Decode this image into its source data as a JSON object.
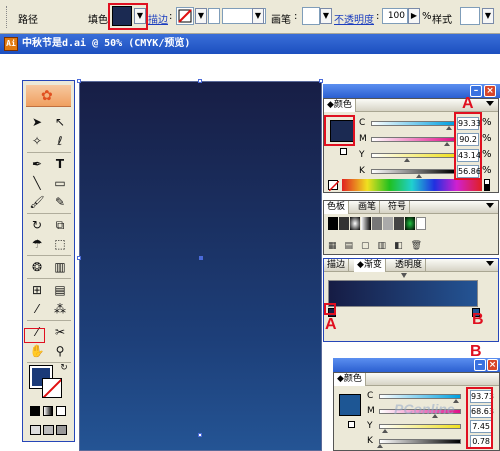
{
  "control_bar": {
    "path_label": "路径",
    "fill_label": "填色",
    "stroke_label": "描边",
    "brush_label": "画笔",
    "opacity_label": "不透明度",
    "opacity_value": "100",
    "opacity_unit": "%",
    "style_label": "样式"
  },
  "document": {
    "title": "中秋节是d.ai @ 50% (CMYK/预览)",
    "icon_text": "Ai"
  },
  "color_panel_top": {
    "tab": "颜色",
    "channels": [
      {
        "name": "C",
        "value": "93.33",
        "level": 93.33
      },
      {
        "name": "M",
        "value": "90.2",
        "level": 90.2
      },
      {
        "name": "Y",
        "value": "43.14",
        "level": 43.14
      },
      {
        "name": "K",
        "value": "56.86",
        "level": 56.86
      }
    ],
    "pct": "%",
    "annotation": "A"
  },
  "swatches_panel": {
    "tabs": [
      "色板",
      "画笔",
      "符号"
    ]
  },
  "gradient_panel": {
    "tabs": [
      "描边",
      "渐变",
      "透明度"
    ],
    "left_marker": "A",
    "right_marker": "B"
  },
  "color_panel_bottom": {
    "tab": "颜色",
    "channels": [
      {
        "name": "C",
        "value": "93.73",
        "level": 93.73
      },
      {
        "name": "M",
        "value": "68.63",
        "level": 68.63
      },
      {
        "name": "Y",
        "value": "7.45",
        "level": 7.45
      },
      {
        "name": "K",
        "value": "0.78",
        "level": 0.78
      }
    ],
    "pct": "%"
  },
  "watermark": "PConline",
  "colors": {
    "gradient_start": "#161c44",
    "gradient_end": "#245494",
    "annotation_red": "#e01020",
    "window_blue": "#2b5fd0"
  },
  "tools": {
    "banner_icon": "flower-icon",
    "items": [
      "selection-tool-icon",
      "direct-selection-tool-icon",
      "magic-wand-icon",
      "lasso-icon",
      "pen-tool-icon",
      "type-tool-icon",
      "line-tool-icon",
      "rectangle-tool-icon",
      "paintbrush-icon",
      "pencil-icon",
      "rotate-tool-icon",
      "scale-tool-icon",
      "warp-tool-icon",
      "free-transform-icon",
      "symbol-sprayer-icon",
      "graph-tool-icon",
      "mesh-tool-icon",
      "gradient-tool-icon",
      "eyedropper-icon",
      "blend-tool-icon",
      "slice-tool-icon",
      "scissors-icon",
      "hand-tool-icon",
      "zoom-tool-icon"
    ]
  }
}
